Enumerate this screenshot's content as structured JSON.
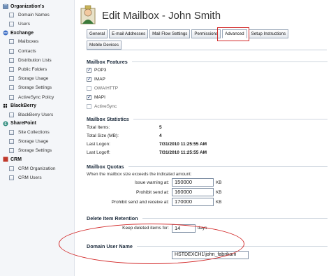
{
  "sidebar": {
    "groups": [
      {
        "label": "Organization's",
        "items": [
          "Domain Names",
          "Users"
        ]
      },
      {
        "label": "Exchange",
        "items": [
          "Mailboxes",
          "Contacts",
          "Distribution Lists",
          "Public Folders",
          "Storage Usage",
          "Storage Settings",
          "ActiveSync Policy"
        ]
      },
      {
        "label": "BlackBerry",
        "items": [
          "BlackBerry Users"
        ]
      },
      {
        "label": "SharePoint",
        "items": [
          "Site Collections",
          "Storage Usage",
          "Storage Settings"
        ]
      },
      {
        "label": "CRM",
        "items": [
          "CRM Organization",
          "CRM Users"
        ]
      }
    ]
  },
  "header": {
    "title": "Edit Mailbox - John Smith"
  },
  "tabs": {
    "row1": [
      "General",
      "E-mail Addresses",
      "Mail Flow Settings",
      "Permissions",
      "Advanced",
      "Setup Instructions"
    ],
    "row2": [
      "Mobile Devices"
    ],
    "active": "Advanced"
  },
  "features": {
    "title": "Mailbox Features",
    "items": [
      {
        "label": "POP3",
        "checked": true,
        "disabled": false
      },
      {
        "label": "IMAP",
        "checked": true,
        "disabled": false
      },
      {
        "label": "OWA/HTTP",
        "checked": false,
        "disabled": true
      },
      {
        "label": "MAPI",
        "checked": true,
        "disabled": false
      },
      {
        "label": "ActiveSync",
        "checked": false,
        "disabled": true
      }
    ]
  },
  "statistics": {
    "title": "Mailbox Statistics",
    "rows": [
      {
        "label": "Total Items:",
        "value": "5"
      },
      {
        "label": "Total Size (MB):",
        "value": "4"
      },
      {
        "label": "Last Logon:",
        "value": "7/31/2010 11:25:55 AM"
      },
      {
        "label": "Last Logoff:",
        "value": "7/31/2010 11:25:55 AM"
      }
    ]
  },
  "quotas": {
    "title": "Mailbox Quotas",
    "note": "When the mailbox size exceeds the indicated amount:",
    "rows": [
      {
        "label": "Issue warning at:",
        "value": "150000",
        "unit": "KB"
      },
      {
        "label": "Prohibit send at:",
        "value": "160000",
        "unit": "KB"
      },
      {
        "label": "Prohibit send and receive at:",
        "value": "170000",
        "unit": "KB"
      }
    ]
  },
  "retention": {
    "title": "Delete Item Retention",
    "label": "Keep deleted items for:",
    "value": "14",
    "unit": "days"
  },
  "domain_user": {
    "title": "Domain User Name",
    "value": "HSTDEXCH1\\john_fabrikam"
  },
  "colors": {
    "highlight": "#d32b2b",
    "section_text": "#1c2b3c"
  }
}
